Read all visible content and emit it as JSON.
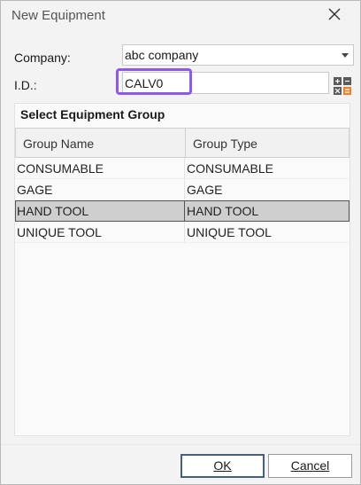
{
  "window": {
    "title": "New Equipment"
  },
  "form": {
    "company_label": "Company:",
    "company_value": "abc company",
    "id_label": "I.D.:",
    "id_value": "CALV0"
  },
  "group": {
    "title": "Select Equipment Group",
    "columns": [
      "Group Name",
      "Group Type"
    ],
    "rows": [
      {
        "name": "CONSUMABLE",
        "type": "CONSUMABLE"
      },
      {
        "name": "GAGE",
        "type": "GAGE"
      },
      {
        "name": "HAND TOOL",
        "type": "HAND TOOL"
      },
      {
        "name": "UNIQUE TOOL",
        "type": "UNIQUE TOOL"
      }
    ],
    "selected_index": 2
  },
  "buttons": {
    "ok": "OK",
    "cancel": "Cancel"
  },
  "icons": {
    "close": "close-icon",
    "calc": "calculator-icon",
    "dropdown": "chevron-down-icon"
  },
  "colors": {
    "focus": "#8a5ae8",
    "selected_row": "#cfcfcf"
  }
}
